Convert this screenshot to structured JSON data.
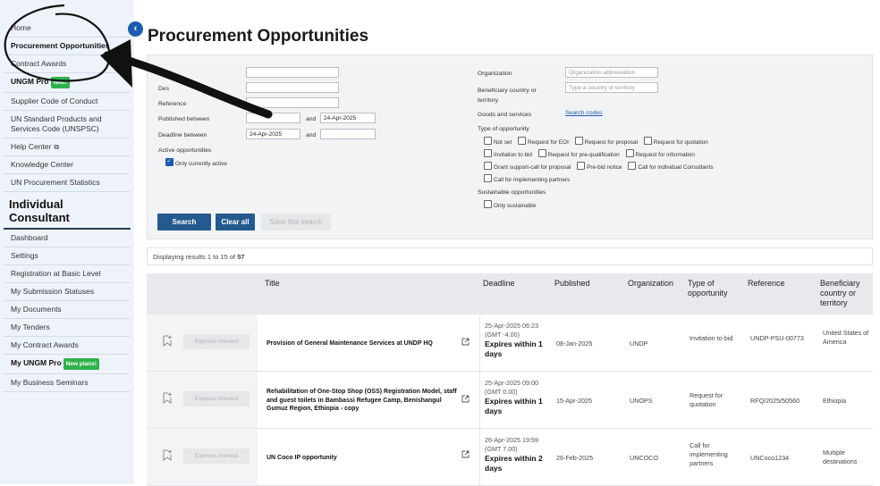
{
  "sidebar": {
    "items_top": [
      {
        "label": "Home"
      },
      {
        "label": "Procurement Opportunities"
      },
      {
        "label": "Contract Awards"
      },
      {
        "label": "UNGM Pro",
        "badge": "New!"
      },
      {
        "label": "Supplier Code of Conduct"
      },
      {
        "label": "UN Standard Products and Services Code (UNSPSC)"
      },
      {
        "label": "Help Center"
      },
      {
        "label": "Knowledge Center"
      },
      {
        "label": "UN Procurement Statistics"
      }
    ],
    "section_heading": "Individual Consultant",
    "items_bottom": [
      {
        "label": "Dashboard"
      },
      {
        "label": "Settings"
      },
      {
        "label": "Registration at Basic Level"
      },
      {
        "label": "My Submission Statuses"
      },
      {
        "label": "My Documents"
      },
      {
        "label": "My Tenders"
      },
      {
        "label": "My Contract Awards"
      },
      {
        "label": "My UNGM Pro",
        "badge": "New plans!"
      },
      {
        "label": "My Business Seminars"
      }
    ]
  },
  "page_title": "Procurement Opportunities",
  "search": {
    "labels": {
      "desc_fragment": "Des",
      "reference": "Reference",
      "published_between": "Published between",
      "deadline_between": "Deadline between",
      "and": "and",
      "active_opportunities": "Active opportunities",
      "only_currently_active": "Only currently active",
      "organization": "Organization",
      "beneficiary": "Beneficiary country or territory",
      "goods_services": "Goods and services",
      "search_codes": "Search codes",
      "type_of_opportunity": "Type of opportunity",
      "sustainable": "Sustainable opportunities",
      "only_sustainable": "Only sustainable"
    },
    "values": {
      "published_to": "24-Apr-2025",
      "deadline_from": "24-Apr-2025"
    },
    "placeholders": {
      "organization": "Organization abbreviation",
      "beneficiary": "Type a country or territory"
    },
    "types": [
      "Not set",
      "Request for EOI",
      "Request for proposal",
      "Request for quotation",
      "Invitation to bid",
      "Request for pre-qualification",
      "Request for information",
      "Grant support-call for proposal",
      "Pre-bid notice",
      "Call for individual Consultants",
      "Call for implementing partners"
    ],
    "buttons": {
      "search": "Search",
      "clear_all": "Clear all",
      "save": "Save this search"
    }
  },
  "results": {
    "prefix": "Displaying results 1 to 15 of ",
    "total": "57"
  },
  "table": {
    "headers": {
      "title": "Title",
      "deadline": "Deadline",
      "published": "Published",
      "organization": "Organization",
      "type": "Type of opportunity",
      "reference": "Reference",
      "beneficiary": "Beneficiary country or territory"
    },
    "express_label": "Express Interest",
    "rows": [
      {
        "title": "Provision of General Maintenance Services at UNDP HQ",
        "deadline_date": "25-Apr-2025 06:23 (GMT -4.00)",
        "deadline_expires": "Expires within 1 days",
        "published": "08-Jan-2025",
        "organization": "UNDP",
        "type": "Invitation to bid",
        "reference": "UNDP-PSU-00773",
        "beneficiary": "United States of America"
      },
      {
        "title": "Rehabilitation of One-Stop Shop (OSS) Registration Model, staff and guest toilets in Bambassi Refugee Camp, Benishangul Gumuz Region, Ethiopia - copy",
        "deadline_date": "25-Apr-2025 09:00 (GMT 0.00)",
        "deadline_expires": "Expires within 1 days",
        "published": "15-Apr-2025",
        "organization": "UNOPS",
        "type": "Request for quotation",
        "reference": "RFQ/2025/50560",
        "beneficiary": "Ethiopia"
      },
      {
        "title": "UN Coco IP opportunity",
        "deadline_date": "26-Apr-2025 19:59 (GMT 7.00)",
        "deadline_expires": "Expires within 2 days",
        "published": "26-Feb-2025",
        "organization": "UNCOCO",
        "type": "Call for implementing partners",
        "reference": "UNCoco1234",
        "beneficiary": "Multiple destinations"
      }
    ]
  },
  "icons": {
    "collapse": "chevron-left-icon",
    "external": "external-link-icon",
    "bookmark": "bookmark-add-icon"
  },
  "colors": {
    "accent": "#1c5cb0",
    "primary_button": "#255a8f",
    "badge": "#2eb24a",
    "sidebar_bg": "#eef3fb"
  }
}
